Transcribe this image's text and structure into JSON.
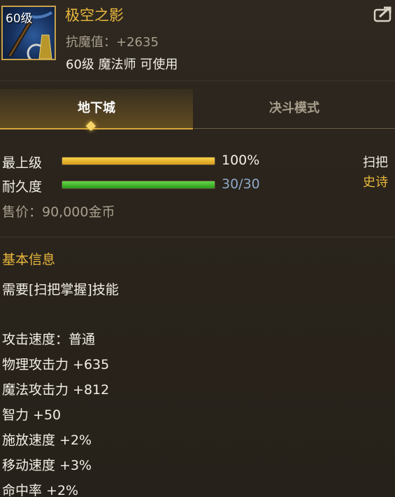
{
  "item": {
    "level_badge": "60级",
    "name": "极空之影",
    "resist": "抗魔值：+2635",
    "requirement": "60级 魔法师 可使用"
  },
  "tabs": [
    {
      "label": "地下城",
      "active": true
    },
    {
      "label": "决斗模式",
      "active": false
    }
  ],
  "stats": {
    "grade": {
      "label": "最上级",
      "value_text": "100%",
      "fill": 1.0
    },
    "durability": {
      "label": "耐久度",
      "value_text": "30/30",
      "fill": 1.0
    }
  },
  "item_type": {
    "category": "扫把",
    "rarity": "史诗"
  },
  "price": "售价：90,000金币",
  "basic_info": {
    "title": "基本信息",
    "skill_req": "需要[扫把掌握]技能",
    "attrs": [
      "攻击速度：普通",
      "物理攻击力 +635",
      "魔法攻击力 +812",
      "智力 +50",
      "施放速度 +2%",
      "移动速度 +3%",
      "命中率 +2%"
    ]
  },
  "colors": {
    "gold": "#e9b83d",
    "epic": "#e9b83d",
    "durability": "#8fa8c8",
    "muted": "#a89e8c"
  },
  "icons": {
    "share": "share-arrow-icon",
    "item": "broom-weapon-icon"
  }
}
